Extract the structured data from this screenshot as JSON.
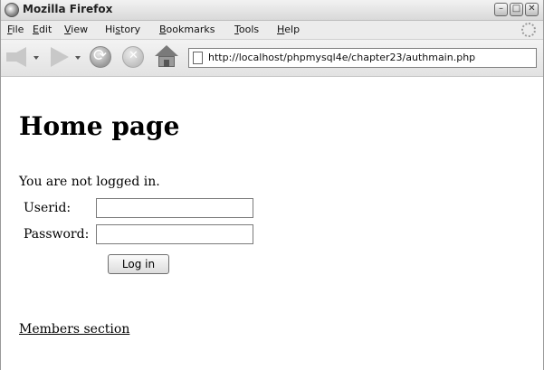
{
  "window": {
    "title": "Mozilla Firefox",
    "controls": [
      "–",
      "□",
      "✕"
    ]
  },
  "menubar": {
    "items": [
      {
        "label": "File",
        "u": "F",
        "rest": "ile"
      },
      {
        "label": "Edit",
        "u": "E",
        "rest": "dit"
      },
      {
        "label": "View",
        "u": "V",
        "rest": "iew"
      },
      {
        "label": "History",
        "pre": "Hi",
        "u": "s",
        "rest": "tory"
      },
      {
        "label": "Bookmarks",
        "u": "B",
        "rest": "ookmarks"
      },
      {
        "label": "Tools",
        "u": "T",
        "rest": "ools"
      },
      {
        "label": "Help",
        "u": "H",
        "rest": "elp"
      }
    ]
  },
  "navbar": {
    "back_icon": "back-arrow-icon",
    "forward_icon": "forward-arrow-icon",
    "reload_icon": "reload-icon",
    "stop_icon": "stop-icon",
    "home_icon": "home-icon",
    "url": "http://localhost/phpmysql4e/chapter23/authmain.php"
  },
  "page": {
    "heading": "Home page",
    "status": "You are not logged in.",
    "form": {
      "userid_label": "Userid:",
      "userid_value": "",
      "password_label": "Password:",
      "password_value": "",
      "submit_label": "Log in"
    },
    "members_link": "Members section"
  }
}
